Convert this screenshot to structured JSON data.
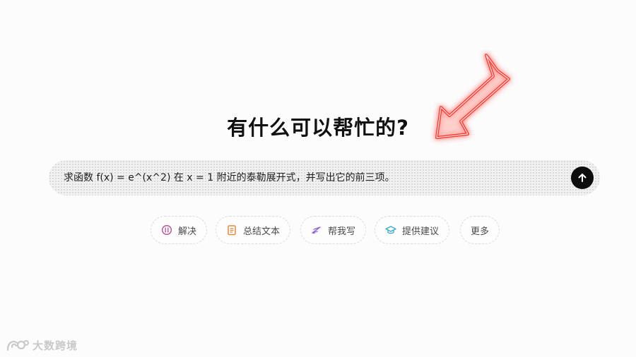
{
  "heading": "有什么可以帮忙的?",
  "composer": {
    "value": "求函数 f(x) = e^(x^2) 在 x = 1 附近的泰勒展开式，并写出它的前三项。"
  },
  "send_icon": "arrow-up-icon",
  "chips": [
    {
      "label": "解决",
      "icon": "solve-icon",
      "color": "#c0579a"
    },
    {
      "label": "总结文本",
      "icon": "document-icon",
      "color": "#e08a3c"
    },
    {
      "label": "帮我写",
      "icon": "pen-icon",
      "color": "#8a6ae0"
    },
    {
      "label": "提供建议",
      "icon": "graduation-cap-icon",
      "color": "#3aa8c8"
    },
    {
      "label": "更多",
      "icon": "",
      "color": ""
    }
  ],
  "watermark": {
    "text": "大数跨境"
  },
  "colors": {
    "arrow": "#ff3b30",
    "send_button": "#0d0d0d",
    "composer_bg": "#f1f1f1"
  }
}
